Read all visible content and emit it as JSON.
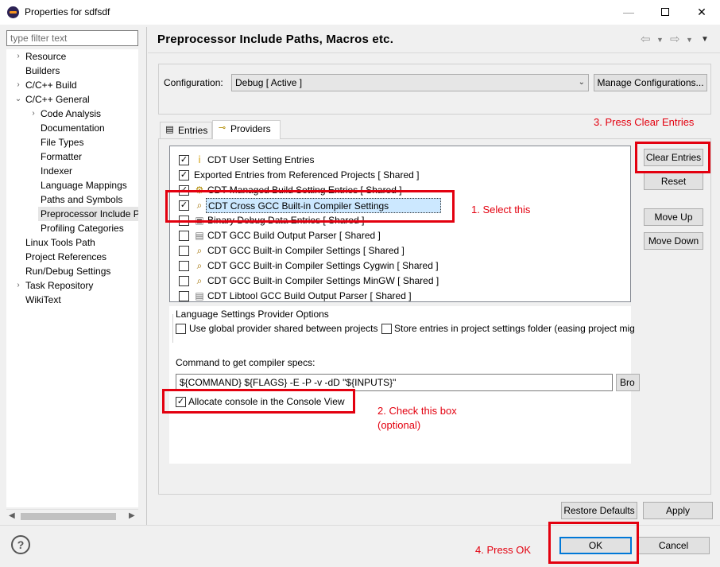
{
  "window": {
    "title": "Properties for sdfsdf",
    "minimize_glyph": "—",
    "close_glyph": "✕"
  },
  "sidebar": {
    "filter_placeholder": "type filter text",
    "items": [
      {
        "label": "Resource",
        "arrow": ">"
      },
      {
        "label": "Builders",
        "arrow": ""
      },
      {
        "label": "C/C++ Build",
        "arrow": ">"
      },
      {
        "label": "C/C++ General",
        "arrow": "v"
      },
      {
        "label": "Code Analysis",
        "arrow": ">"
      },
      {
        "label": "Documentation",
        "arrow": ""
      },
      {
        "label": "File Types",
        "arrow": ""
      },
      {
        "label": "Formatter",
        "arrow": ""
      },
      {
        "label": "Indexer",
        "arrow": ""
      },
      {
        "label": "Language Mappings",
        "arrow": ""
      },
      {
        "label": "Paths and Symbols",
        "arrow": ""
      },
      {
        "label": "Preprocessor Include Pa",
        "arrow": ""
      },
      {
        "label": "Profiling Categories",
        "arrow": ""
      },
      {
        "label": "Linux Tools Path",
        "arrow": ""
      },
      {
        "label": "Project References",
        "arrow": ""
      },
      {
        "label": "Run/Debug Settings",
        "arrow": ""
      },
      {
        "label": "Task Repository",
        "arrow": ">"
      },
      {
        "label": "WikiText",
        "arrow": ""
      }
    ]
  },
  "page": {
    "title": "Preprocessor Include Paths, Macros etc.",
    "configuration_label": "Configuration:",
    "configuration_value": "Debug  [ Active ]",
    "manage_button": "Manage Configurations...",
    "tabs": [
      {
        "label": "Entries",
        "icon": "entries-icon"
      },
      {
        "label": "Providers",
        "icon": "providers-icon"
      }
    ],
    "providers": [
      {
        "label": "CDT User Setting Entries",
        "checked": true,
        "icon": "user-icon"
      },
      {
        "label": "Exported Entries from Referenced Projects   [ Shared ]",
        "checked": true,
        "icon": ""
      },
      {
        "label": "CDT Managed Build Setting Entries   [ Shared ]",
        "checked": true,
        "icon": "managed-icon"
      },
      {
        "label": "CDT Cross GCC Built-in Compiler Settings",
        "checked": true,
        "icon": "compiler-icon"
      },
      {
        "label": "Binary Debug Data Entries   [ Shared ]",
        "checked": false,
        "icon": "binary-icon"
      },
      {
        "label": "CDT GCC Build Output Parser   [ Shared ]",
        "checked": false,
        "icon": "parser-icon"
      },
      {
        "label": "CDT GCC Built-in Compiler Settings   [ Shared ]",
        "checked": false,
        "icon": "compiler-icon"
      },
      {
        "label": "CDT GCC Built-in Compiler Settings Cygwin   [ Shared ]",
        "checked": false,
        "icon": "compiler-icon"
      },
      {
        "label": "CDT GCC Built-in Compiler Settings MinGW   [ Shared ]",
        "checked": false,
        "icon": "compiler-icon"
      },
      {
        "label": "CDT Libtool GCC Build Output Parser   [ Shared ]",
        "checked": false,
        "icon": "parser-icon"
      }
    ],
    "side_buttons": {
      "clear": "Clear Entries",
      "reset": "Reset",
      "move_up": "Move Up",
      "move_down": "Move Down"
    },
    "options_group_title": "Language Settings Provider Options",
    "use_global_label": "Use global provider shared between projects",
    "store_entries_label": "Store entries in project settings folder (easing project mig",
    "command_label": "Command to get compiler specs:",
    "command_value": "${COMMAND} ${FLAGS} -E -P -v -dD \"${INPUTS}\"",
    "browse_label": "Bro",
    "allocate_console_label": "Allocate console in the Console View",
    "restore_defaults": "Restore Defaults",
    "apply": "Apply"
  },
  "footer": {
    "ok": "OK",
    "cancel": "Cancel",
    "help_glyph": "?"
  },
  "annotations": {
    "step1": "1. Select this",
    "step2_line1": "2. Check this box",
    "step2_line2": "(optional)",
    "step3": "3. Press Clear Entries",
    "step4": "4. Press OK"
  },
  "colors": {
    "annotation_red": "#e3000f",
    "selection_blue": "#cce8ff",
    "default_button_border": "#0078d7"
  }
}
